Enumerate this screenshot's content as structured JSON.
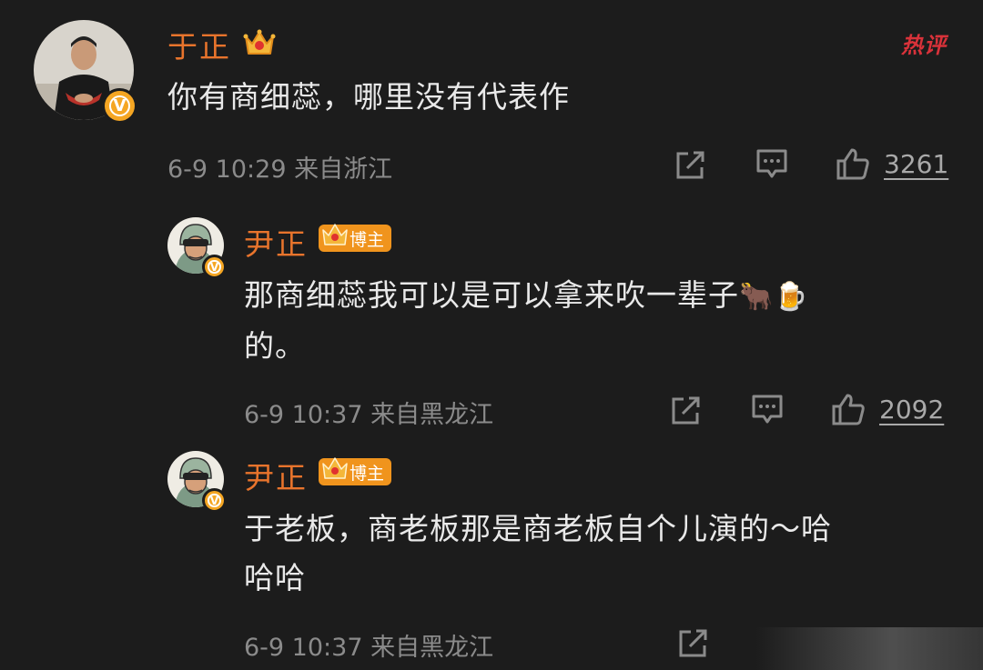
{
  "hot_label": "热评",
  "comments": [
    {
      "username": "于正",
      "content": "你有商细蕊，哪里没有代表作",
      "time": "6-9 10:29",
      "location": "来自浙江",
      "likes": "3261"
    },
    {
      "username": "尹正",
      "tag": "博主",
      "content_line1": "那商细蕊我可以是可以拿来吹一辈子",
      "emoji": "🐂🍺",
      "content_line2": "的。",
      "time": "6-9 10:37",
      "location": "来自黑龙江",
      "likes": "2092"
    },
    {
      "username": "尹正",
      "tag": "博主",
      "content_line1": "于老板，商老板那是商老板自个儿演的～哈",
      "content_line2": "哈哈",
      "time": "6-9 10:37",
      "location": "来自黑龙江"
    }
  ],
  "icons": {
    "share": "share-icon",
    "comment": "comment-icon",
    "like": "thumbs-up-icon",
    "crown": "crown-icon",
    "verified": "verified-v-icon"
  },
  "colors": {
    "background": "#1c1c1c",
    "username": "#e8742c",
    "text": "#e9e9e9",
    "meta": "#8b8b8b",
    "verified": "#f5a623",
    "hot": "#d9323a"
  }
}
